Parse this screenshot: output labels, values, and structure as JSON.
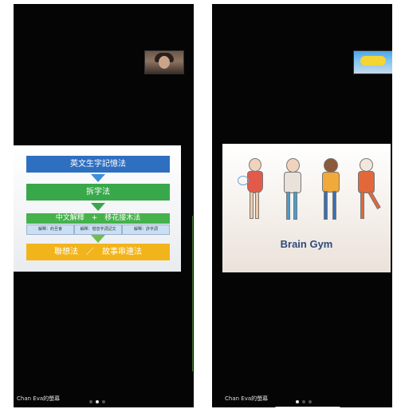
{
  "left": {
    "slide": {
      "box1": "英文生字記憶法",
      "box2": "拆字法",
      "box3": "中文解釋　+　移花接木法",
      "sub": [
        "解釋：約旦會",
        "解釋：借音字詞記文",
        "解釋：許字詞"
      ],
      "box4": "聯想法　／　故事串連法"
    },
    "caption": "Chan Eva的螢幕",
    "page_dots": 3,
    "active_dot": 2
  },
  "right": {
    "pip_banner": "",
    "slide": {
      "title": "Brain Gym"
    },
    "caption": "Chan Eva的螢幕",
    "page_dots": 3,
    "active_dot": 1
  },
  "colors": {
    "blue": "#2f6fc0",
    "green": "#38a84a",
    "yellow": "#f2b41b",
    "title": "#2e4b7a"
  }
}
